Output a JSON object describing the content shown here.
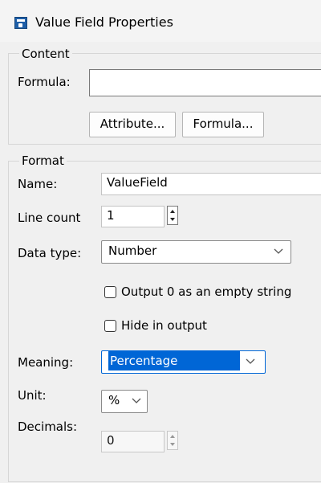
{
  "window": {
    "title": "Value Field Properties"
  },
  "content_group": {
    "title": "Content",
    "formula_label": "Formula:",
    "formula_value": "",
    "attribute_button": "Attribute...",
    "formula_button": "Formula..."
  },
  "format_group": {
    "title": "Format",
    "name_label": "Name:",
    "name_value": "ValueField",
    "line_count_label": "Line count",
    "line_count_value": "1",
    "data_type_label": "Data type:",
    "data_type_value": "Number",
    "checkbox_empty_string": {
      "label": "Output 0 as an empty string",
      "checked": false
    },
    "checkbox_hide_output": {
      "label": "Hide in output",
      "checked": false
    },
    "meaning_label": "Meaning:",
    "meaning_value": "Percentage",
    "unit_label": "Unit:",
    "unit_value": "%",
    "decimals_label": "Decimals:",
    "decimals_value": "0"
  },
  "icons": {
    "window": "window-icon",
    "dropdown": "chevron-down-icon",
    "spin": "spin-up-down-icon"
  },
  "colors": {
    "window_bg": "#f0f0f0",
    "selection": "#0066d6",
    "window_icon": "#1f5fa8"
  }
}
